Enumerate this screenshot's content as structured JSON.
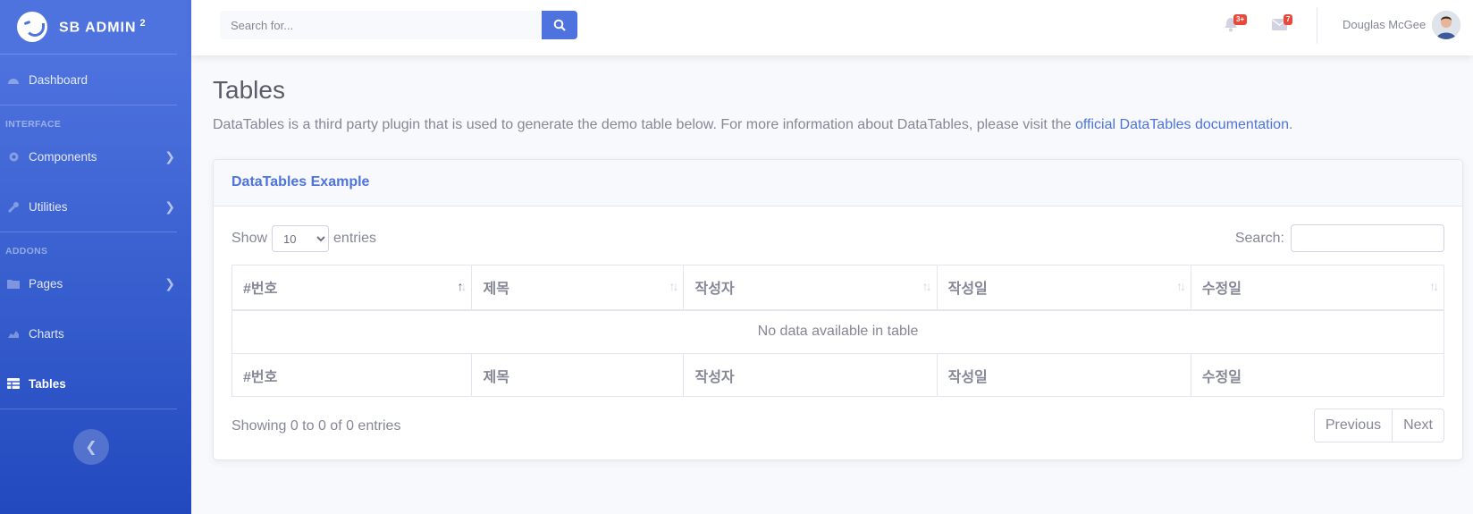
{
  "brand": {
    "name": "SB ADMIN",
    "sup": "2"
  },
  "sidebar": {
    "dashboard": "Dashboard",
    "section_interface": "INTERFACE",
    "components": "Components",
    "utilities": "Utilities",
    "section_addons": "ADDONS",
    "pages": "Pages",
    "charts": "Charts",
    "tables": "Tables"
  },
  "topbar": {
    "search_placeholder": "Search for...",
    "alerts_badge": "3+",
    "messages_badge": "7",
    "user_name": "Douglas McGee"
  },
  "page": {
    "title": "Tables",
    "description": "DataTables is a third party plugin that is used to generate the demo table below. For more information about DataTables, please visit the ",
    "link_text": "official DataTables documentation",
    "description_end": "."
  },
  "card": {
    "title": "DataTables Example",
    "show_label": "Show",
    "entries_value": "10",
    "entries_label": "entries",
    "search_label": "Search:",
    "columns": [
      "#번호",
      "제목",
      "작성자",
      "작성일",
      "수정일"
    ],
    "empty_text": "No data available in table",
    "info_text": "Showing 0 to 0 of 0 entries",
    "prev_label": "Previous",
    "next_label": "Next"
  },
  "colors": {
    "primary": "#4e73df",
    "badge": "#e74a3b"
  }
}
